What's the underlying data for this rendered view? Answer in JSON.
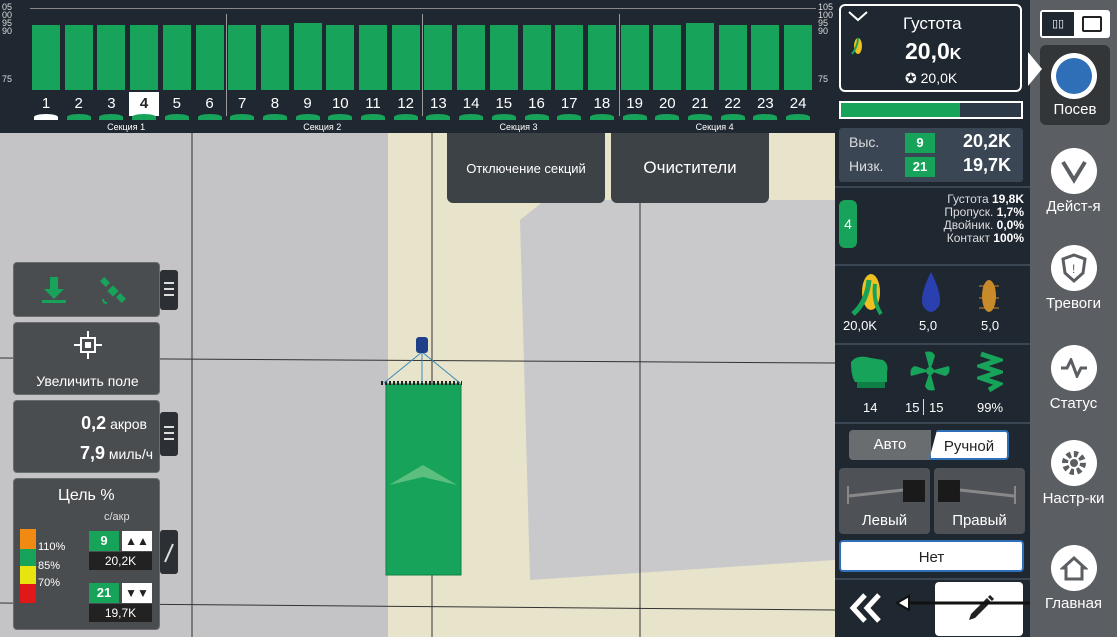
{
  "top": {
    "rows": [
      "1",
      "2",
      "3",
      "4",
      "5",
      "6",
      "7",
      "8",
      "9",
      "10",
      "11",
      "12",
      "13",
      "14",
      "15",
      "16",
      "17",
      "18",
      "19",
      "20",
      "21",
      "22",
      "23",
      "24"
    ],
    "selected_row": "4",
    "row_levels": [
      100,
      100,
      100,
      100,
      100,
      100,
      100,
      100,
      101,
      100,
      100,
      100,
      100,
      100,
      100,
      100,
      100,
      100,
      100,
      100,
      101,
      100,
      100,
      100
    ],
    "sections": [
      "Секция 1",
      "Секция 2",
      "Секция 3",
      "Секция 4"
    ],
    "scale_left": [
      "05",
      "00",
      "95",
      "90",
      "75"
    ],
    "scale_right": [
      "105",
      "100",
      "95",
      "90",
      "75"
    ]
  },
  "map": {
    "btn_sections_off": "Отключение секций",
    "btn_cleaners": "Очистители"
  },
  "left": {
    "zoom_label": "Увеличить поле",
    "area_value": "0,2",
    "area_unit": "акров",
    "speed_value": "7,9",
    "speed_unit": "миль/ч",
    "target_title": "Цель %",
    "target_unit": "с/акр",
    "legend": [
      "110%",
      "85%",
      "70%"
    ],
    "high_row": "9",
    "high_value": "20,2K",
    "low_row": "21",
    "low_value": "19,7K"
  },
  "right": {
    "density_label": "Густота",
    "density_value": "20,0",
    "density_suffix": "K",
    "density_target": "20,0K",
    "high_label": "Выс.",
    "high_row": "9",
    "high_value": "20,2K",
    "low_label": "Низк.",
    "low_row": "21",
    "low_value": "19,7K",
    "row_num": "4",
    "stat_density_label": "Густота",
    "stat_density_value": "19,8K",
    "stat_skip_label": "Пропуск.",
    "stat_skip_value": "1,7%",
    "stat_double_label": "Двойник.",
    "stat_double_value": "0,0%",
    "stat_contact_label": "Контакт",
    "stat_contact_value": "100%",
    "products": [
      "20,0K",
      "5,0",
      "5,0"
    ],
    "equip": [
      "14",
      "15",
      "15",
      "99%"
    ],
    "mode_auto": "Авто",
    "mode_manual": "Ручной",
    "left_label": "Левый",
    "right_label": "Правый",
    "none_label": "Нет"
  },
  "nav": {
    "items": [
      "Посев",
      "Дейст-я",
      "Тревоги",
      "Статус",
      "Настр-ки",
      "Главная"
    ]
  },
  "colors": {
    "accent_green": "#17a35a",
    "panel_dark": "#1f2730",
    "nav_bg": "#5b5e62",
    "field_tan": "#e8e4c8"
  }
}
